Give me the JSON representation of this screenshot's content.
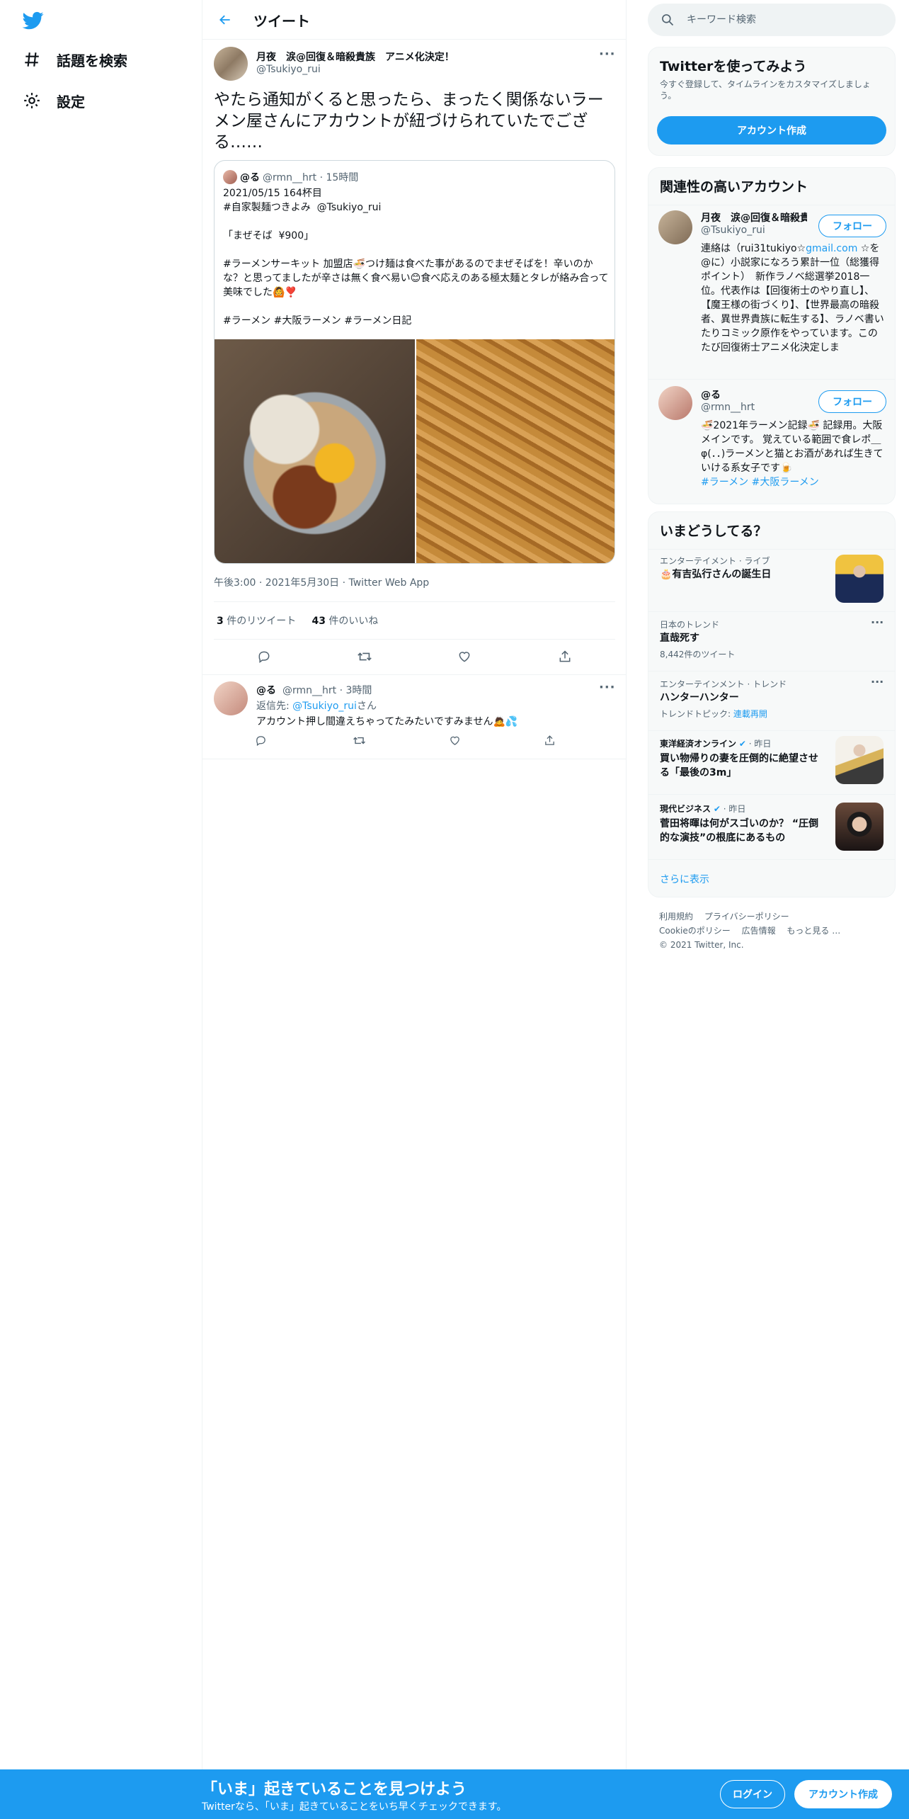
{
  "nav": {
    "logo": "twitter-bird-icon",
    "items": [
      {
        "label": "話題を検索",
        "icon": "hashtag-icon"
      },
      {
        "label": "設定",
        "icon": "gear-icon"
      }
    ]
  },
  "header": {
    "title": "ツイート"
  },
  "tweet": {
    "name": "月夜　涙@回復＆暗殺貴族　アニメ化決定！",
    "handle": "@Tsukiyo_rui",
    "text": "やたら通知がくると思ったら、まったく関係ないラーメン屋さんにアカウントが紐づけられていたでござる……",
    "quote": {
      "name": "@る",
      "handle_time": "@rmn__hrt · 15時間",
      "body": "2021/05/15 164杯目\n#自家製麺つきよみ  @Tsukiyo_rui\n\n「まぜそば  ¥900」\n\n#ラーメンサーキット 加盟店🍜つけ麺は食べた事があるのでまぜそばを！辛いのかな？と思ってましたが辛さは無く食べ易い😊食べ応えのある極太麺とタレが絡み合って美味でした🙆❣️\n\n#ラーメン #大阪ラーメン #ラーメン日記"
    },
    "meta": "午後3:00 · 2021年5月30日 · Twitter Web App",
    "retweets": "3",
    "retweets_label": "件のリツイート",
    "likes": "43",
    "likes_label": "件のいいね"
  },
  "reply": {
    "name": "@る",
    "handle_time": "@rmn__hrt · 3時間",
    "reply_prefix": "返信先: ",
    "reply_to": "@Tsukiyo_rui",
    "reply_suffix": "さん",
    "text": "アカウント押し間違えちゃってたみたいですみません🙇💦"
  },
  "sidebar": {
    "search_placeholder": "キーワード検索",
    "signup": {
      "title": "Twitterを使ってみよう",
      "subtitle": "今すぐ登録して、タイムラインをカスタマイズしましょう。",
      "button": "アカウント作成"
    },
    "related": {
      "title": "関連性の高いアカウント",
      "follow": "フォロー",
      "accounts": [
        {
          "name": "月夜　涙@回復＆暗殺貴族　アニメ化決定！",
          "handle": "@Tsukiyo_rui",
          "bio_pre": "連絡は（rui31tukiyo☆",
          "bio_link": "gmail.com",
          "bio_post": " ☆を@に）小説家になろう累計一位（総獲得ポイント）　新作ラノベ総選挙2018一位。代表作は【回復術士のやり直し】、【魔王様の街づくり】、【世界最高の暗殺者、異世界貴族に転生する】、ラノベ書いたりコミック原作をやっています。このたび回復術士アニメ化決定しま"
        },
        {
          "name": "@る",
          "handle": "@rmn__hrt",
          "bio_pre": "🍜2021年ラーメン記録🍜 記録用。大阪メインです。 覚えている範囲で食レポ＿φ(．．)ラーメンと猫とお酒があれば生きていける系女子です🍺",
          "bio_link": "#ラーメン #大阪ラーメン",
          "bio_post": ""
        }
      ]
    },
    "trends": {
      "title": "いまどうしてる？",
      "items": [
        {
          "category": "エンターテイメント · ライブ",
          "title": "🎂有吉弘行さんの誕生日",
          "sub": ""
        },
        {
          "category": "日本のトレンド",
          "title": "直哉死す",
          "sub": "8,442件のツイート"
        },
        {
          "category": "エンターテインメント · トレンド",
          "title": "ハンターハンター",
          "sub_prefix": "トレンドトピック: ",
          "sub_link": "連載再開"
        },
        {
          "category_source": "東洋経済オンライン",
          "category_time": " · 昨日",
          "title": "買い物帰りの妻を圧倒的に絶望させる「最後の3m」"
        },
        {
          "category_source": "現代ビジネス",
          "category_time": " · 昨日",
          "title": "菅田将暉は何がスゴいのか？ “圧倒的な演技”の根底にあるもの"
        }
      ],
      "show_more": "さらに表示"
    },
    "footer": {
      "links": [
        "利用規約",
        "プライバシーポリシー",
        "Cookieのポリシー",
        "広告情報",
        "もっと見る …"
      ],
      "copyright": "© 2021 Twitter, Inc."
    }
  },
  "bottom_bar": {
    "title": "「いま」起きていることを見つけよう",
    "subtitle": "Twitterなら、「いま」起きていることをいち早くチェックできます。",
    "login": "ログイン",
    "signup": "アカウント作成"
  },
  "colors": {
    "accent": "#1d9bf0",
    "text": "#0f1419",
    "secondary": "#536471"
  }
}
